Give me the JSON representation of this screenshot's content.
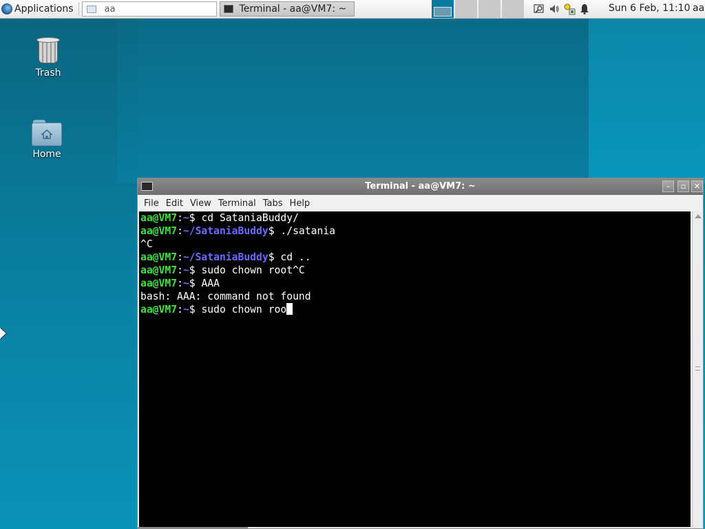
{
  "top_panel": {
    "applications_label": "Applications",
    "tasks": [
      {
        "label": "aa"
      },
      {
        "label": "Terminal - aa@VM7: ~"
      }
    ],
    "workspaces": 4,
    "active_workspace": 1,
    "clock": "Sun  6 Feb, 11:10",
    "user": "aa",
    "tray_icons": [
      "search-icon",
      "volume-icon",
      "network-icon",
      "notification-bell-icon"
    ]
  },
  "desktop": {
    "icons": [
      {
        "label": "Trash",
        "icon": "trash-icon"
      },
      {
        "label": "Home",
        "icon": "home-folder-icon"
      }
    ]
  },
  "terminal": {
    "title": "Terminal - aa@VM7: ~",
    "menu": [
      "File",
      "Edit",
      "View",
      "Terminal",
      "Tabs",
      "Help"
    ],
    "colors": {
      "user": "#3fe13f",
      "path": "#6a6aff",
      "text": "#ffffff",
      "background": "#000000"
    },
    "lines": [
      {
        "user": "aa@VM7",
        "path": "~",
        "cmd": "cd SataniaBuddy/"
      },
      {
        "user": "aa@VM7",
        "path": "~/SataniaBuddy",
        "cmd": "./satania"
      },
      {
        "output": "^C"
      },
      {
        "user": "aa@VM7",
        "path": "~/SataniaBuddy",
        "cmd": "cd .."
      },
      {
        "user": "aa@VM7",
        "path": "~",
        "cmd": "sudo chown root^C"
      },
      {
        "user": "aa@VM7",
        "path": "~",
        "cmd": "AAA"
      },
      {
        "output": "bash: AAA: command not found"
      },
      {
        "user": "aa@VM7",
        "path": "~",
        "cmd": "sudo chown roo",
        "cursor": true
      }
    ]
  }
}
